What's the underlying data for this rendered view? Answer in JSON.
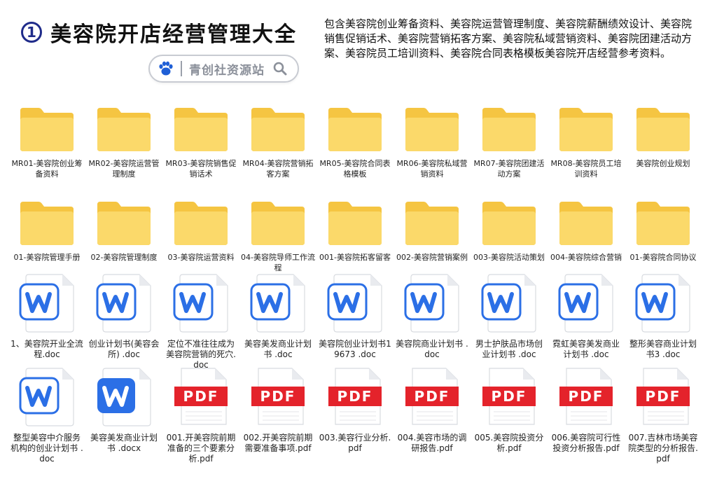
{
  "header": {
    "number": "1",
    "title": "美容院开店经营管理大全",
    "search_text": "青创社资源站",
    "description": "包含美容院创业筹备资料、美容院运营管理制度、美容院薪酬绩效设计、美容院销售促销话术、美容院营销拓客方案、美容院私域营销资料、美容院团建活动方案、美容院员工培训资料、美容院合同表格模板美容院开店经营参考资料。"
  },
  "colors": {
    "folder_back": "#f5c542",
    "folder_front": "#fbd96a",
    "word_blue": "#2b6fe6",
    "pdf_red": "#e4232b"
  },
  "rows": [
    [
      {
        "type": "folder",
        "label": "MR01-美容院创业筹备资料"
      },
      {
        "type": "folder",
        "label": "MR02-美容院运营管理制度"
      },
      {
        "type": "folder",
        "label": "MR03-美容院销售促销话术"
      },
      {
        "type": "folder",
        "label": "MR04-美容院营销拓客方案"
      },
      {
        "type": "folder",
        "label": "MR05-美容院合同表格模板"
      },
      {
        "type": "folder",
        "label": "MR06-美容院私域营销资料"
      },
      {
        "type": "folder",
        "label": "MR07-美容院团建活动方案"
      },
      {
        "type": "folder",
        "label": "MR08-美容院员工培训资料"
      },
      {
        "type": "folder",
        "label": "美容院创业规划"
      }
    ],
    [
      {
        "type": "folder",
        "label": "01-美容院管理手册"
      },
      {
        "type": "folder",
        "label": "02-美容院管理制度"
      },
      {
        "type": "folder",
        "label": "03-美容院运营资料"
      },
      {
        "type": "folder",
        "label": "04-美容院导师工作流程"
      },
      {
        "type": "folder",
        "label": "001-美容院拓客留客"
      },
      {
        "type": "folder",
        "label": "002-美容院营销案例"
      },
      {
        "type": "folder",
        "label": "003-美容院活动策划"
      },
      {
        "type": "folder",
        "label": "004-美容院综合营销"
      },
      {
        "type": "folder",
        "label": "01-美容院合同协议"
      }
    ],
    [
      {
        "type": "word",
        "label": "1、美容院开业全流程.doc"
      },
      {
        "type": "word",
        "label": "创业计划书(美容会所) .doc"
      },
      {
        "type": "word",
        "label": "定位不准往往成为美容院营销的死穴.doc"
      },
      {
        "type": "word",
        "label": "美容美发商业计划书 .doc"
      },
      {
        "type": "word",
        "label": "美容院创业计划书19673 .doc"
      },
      {
        "type": "word",
        "label": "美容院商业计划书 .doc"
      },
      {
        "type": "word",
        "label": "男士护肤品市场创业计划书 .doc"
      },
      {
        "type": "word",
        "label": "霓虹美容美发商业计划书 .doc"
      },
      {
        "type": "word",
        "label": "整形美容商业计划书3 .doc"
      }
    ],
    [
      {
        "type": "word",
        "label": "整型美容中介服务机构的创业计划书 .doc"
      },
      {
        "type": "word-blue",
        "label": "美容美发商业计划书 .docx"
      },
      {
        "type": "pdf",
        "label": "001.开美容院前期准备的三个要素分析.pdf"
      },
      {
        "type": "pdf",
        "label": "002.开美容院前期需要准备事项.pdf"
      },
      {
        "type": "pdf",
        "label": "003.美容行业分析.pdf"
      },
      {
        "type": "pdf",
        "label": "004.美容市场的调研报告.pdf"
      },
      {
        "type": "pdf",
        "label": "005.美容院投资分析.pdf"
      },
      {
        "type": "pdf",
        "label": "006.美容院可行性投资分析报告.pdf"
      },
      {
        "type": "pdf",
        "label": "007.吉林市场美容院类型的分析报告.pdf"
      }
    ]
  ],
  "pdf_badge": "PDF",
  "word_letter": "W"
}
